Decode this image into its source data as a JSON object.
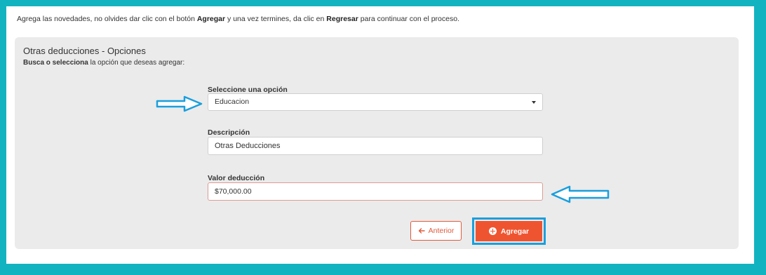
{
  "instructions": {
    "part1": "Agrega las novedades, no olvides dar clic con el botón ",
    "bold1": "Agregar",
    "part2": " y una vez termines, da clic en ",
    "bold2": "Regresar",
    "part3": " para continuar con el proceso."
  },
  "panel": {
    "title": "Otras deducciones - Opciones",
    "subtitle_bold": "Busca o selecciona",
    "subtitle_rest": " la opción que deseas agregar:"
  },
  "form": {
    "select_label": "Seleccione una opción",
    "select_value": "Educacion",
    "description_label": "Descripción",
    "description_value": "Otras Deducciones",
    "valor_label": "Valor deducción",
    "valor_value": "$70,000.00"
  },
  "buttons": {
    "anterior_label": "Anterior",
    "agregar_label": "Agregar"
  },
  "colors": {
    "frame": "#12b3c0",
    "accent": "#ef5430",
    "highlight": "#1a9fdd"
  },
  "icons": {
    "select_caret": "chevron-down-icon",
    "anterior": "arrow-left-icon",
    "agregar": "plus-circle-icon",
    "annotation": "annotation-arrow-icon"
  }
}
